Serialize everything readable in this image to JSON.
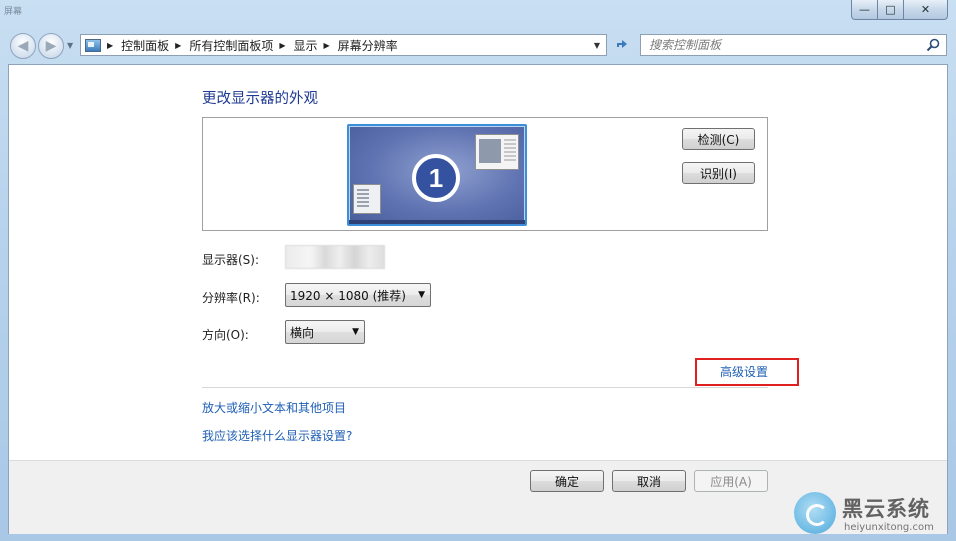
{
  "window": {
    "title": "屏幕",
    "controls": {
      "minimize": "—",
      "maximize": "□",
      "close": "✕"
    }
  },
  "navigation": {
    "breadcrumbs": [
      "控制面板",
      "所有控制面板项",
      "显示",
      "屏幕分辨率"
    ],
    "search_placeholder": "搜索控制面板",
    "icons": {
      "back": "back-arrow-icon",
      "forward": "forward-arrow-icon",
      "refresh": "refresh-icon",
      "search": "magnifier-icon",
      "location": "control-panel-icon"
    }
  },
  "main": {
    "heading": "更改显示器的外观",
    "monitor_number": "1",
    "detect_button": "检测(C)",
    "identify_button": "识别(I)",
    "display_label": "显示器(S):",
    "resolution_label": "分辨率(R):",
    "resolution_value": "1920 × 1080 (推荐)",
    "orientation_label": "方向(O):",
    "orientation_value": "横向",
    "advanced_link": "高级设置",
    "link_text_size": "放大或缩小文本和其他项目",
    "link_which_settings": "我应该选择什么显示器设置?",
    "highlight_color": "#e02020"
  },
  "footer": {
    "ok": "确定",
    "cancel": "取消",
    "apply": "应用(A)"
  },
  "watermark": {
    "title": "黑云系统",
    "url": "heiyunxitong.com"
  }
}
